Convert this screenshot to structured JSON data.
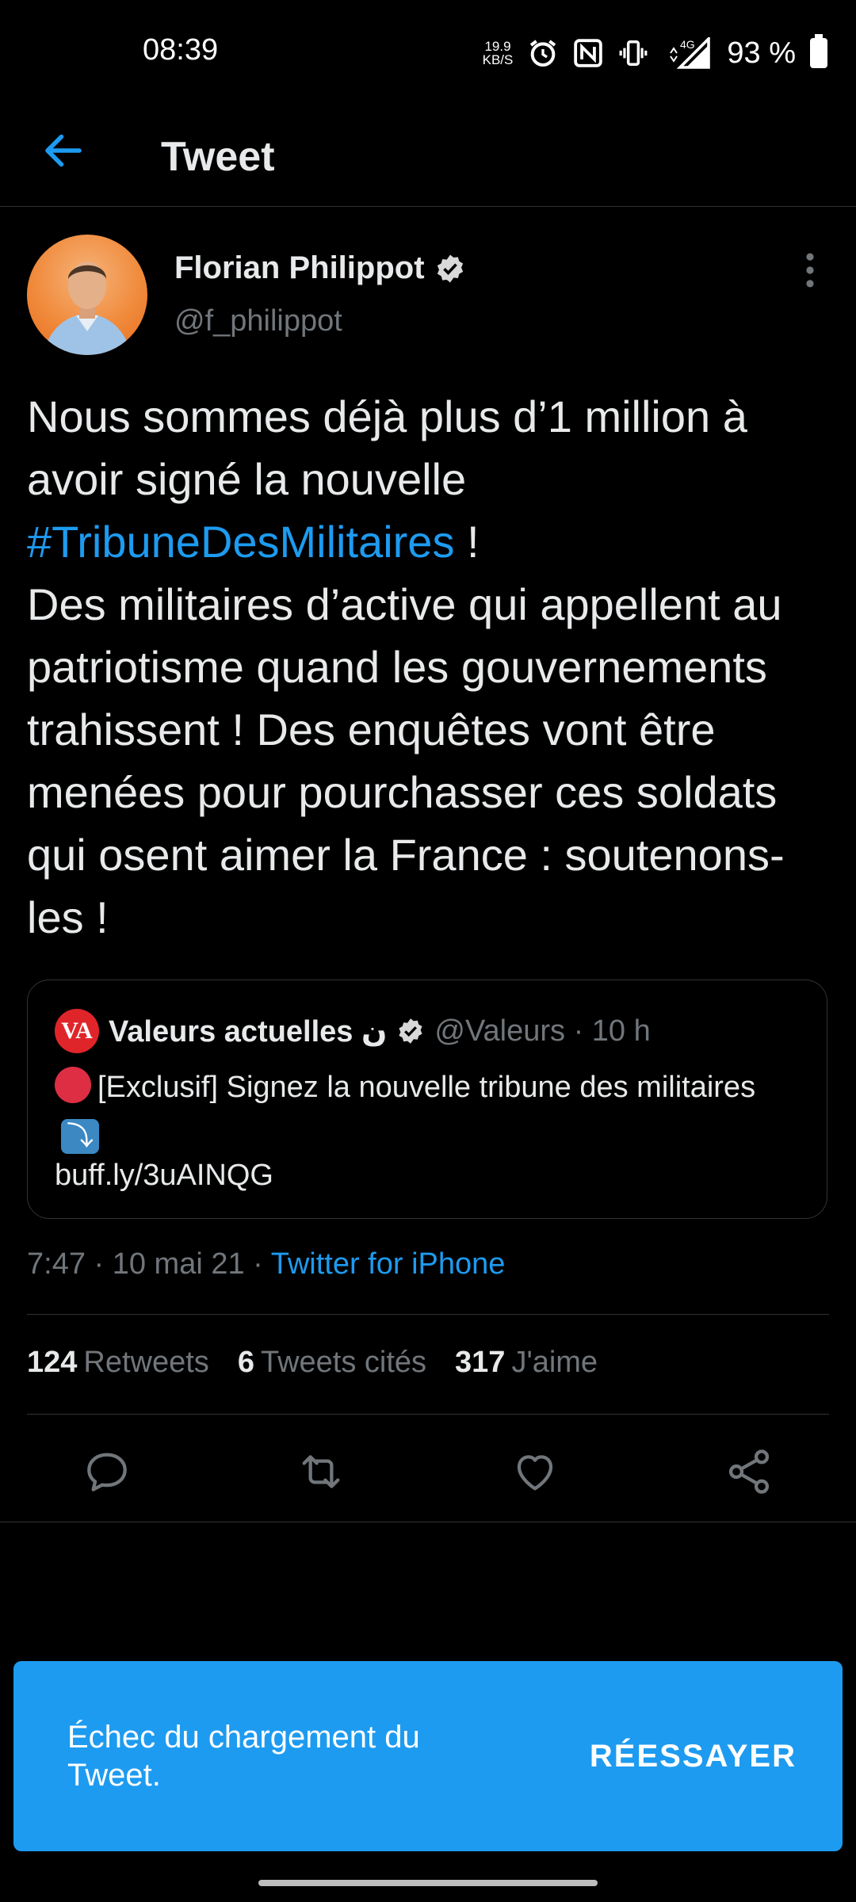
{
  "status_bar": {
    "time": "08:39",
    "net_speed_value": "19.9",
    "net_speed_unit": "KB/S",
    "network_label": "4G",
    "battery": "93 %"
  },
  "header": {
    "title": "Tweet"
  },
  "tweet": {
    "author_name": "Florian Philippot",
    "handle": "@f_philippot",
    "text_line1_a": "Nous sommes déjà plus d’1 million à avoir signé la nouvelle ",
    "hashtag": "#TribuneDesMilitaires",
    "text_line1_b": " !",
    "text_body": "Des militaires d’active qui appellent au patriotisme quand les gouvernements trahissent ! Des enquêtes vont être menées pour pourchasser ces soldats qui osent aimer la France : soutenons-les !",
    "time": "7:47 · 10 mai 21 · ",
    "source": "Twitter for iPhone"
  },
  "quote": {
    "logo_text": "VA",
    "name": "Valeurs actuelles ن",
    "handle_time": "@Valeurs · 10 h",
    "text": "[Exclusif] Signez la nouvelle tribune des militaires",
    "link": "buff.ly/3uAINQG"
  },
  "stats": {
    "retweets_count": "124",
    "retweets_label": "Retweets",
    "quotes_count": "6",
    "quotes_label": "Tweets cités",
    "likes_count": "317",
    "likes_label": "J'aime"
  },
  "toast": {
    "message": "Échec du chargement du Tweet.",
    "button": "RÉESSAYER"
  },
  "colors": {
    "accent": "#1d9bf0",
    "background": "#000000",
    "secondary_text": "#71767b",
    "divider": "#2f3336"
  }
}
